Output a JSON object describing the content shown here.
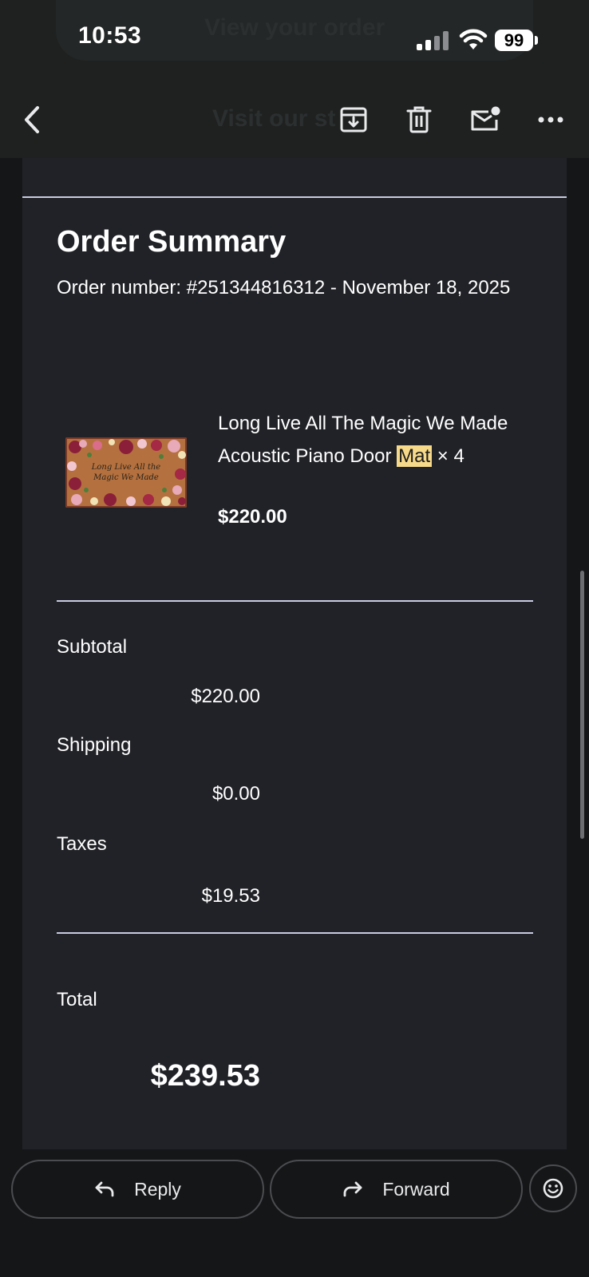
{
  "status_bar": {
    "time": "10:53",
    "battery": "99"
  },
  "toolbar": {
    "ghost_texts": [
      "View your order",
      "Visit our st"
    ]
  },
  "email": {
    "title": "Order Summary",
    "order_line": "Order number: #251344816312 - November 18, 2025",
    "item": {
      "name_before": "Long Live All The Magic We Made Acoustic Piano Door ",
      "name_highlight": "Mat",
      "name_after": " × 4",
      "price": "$220.00",
      "image_text": "Long Live All the Magic We Made"
    },
    "summary": {
      "subtotal_label": "Subtotal",
      "subtotal_value": "$220.00",
      "shipping_label": "Shipping",
      "shipping_value": "$0.00",
      "taxes_label": "Taxes",
      "taxes_value": "$19.53",
      "total_label": "Total",
      "total_value": "$239.53"
    }
  },
  "actions": {
    "reply_label": "Reply",
    "forward_label": "Forward"
  }
}
